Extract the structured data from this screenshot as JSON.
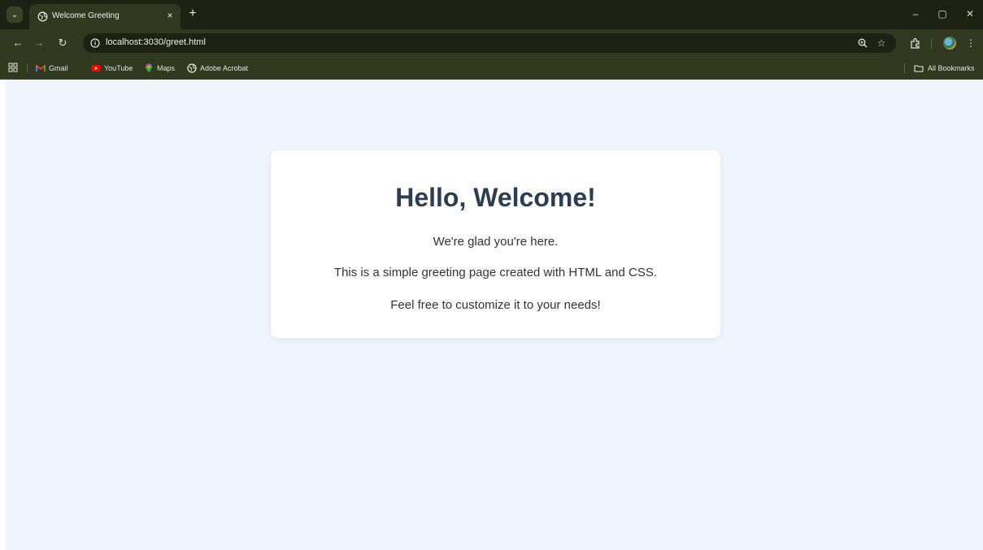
{
  "browser": {
    "tab": {
      "title": "Welcome Greeting",
      "close_symbol": "×",
      "favicon": "globe-icon"
    },
    "new_tab_symbol": "+",
    "window_controls": {
      "minimize": "–",
      "restore": "▢",
      "close": "✕"
    },
    "toolbar": {
      "back": "←",
      "forward": "→",
      "reload": "↻",
      "url": "localhost:3030/greet.html",
      "zoom_icon": "zoom-icon",
      "bookmark_star": "☆",
      "menu": "⋮"
    },
    "bookmarks": [
      {
        "label": "Gmail",
        "icon": "gmail-icon"
      },
      {
        "label": "YouTube",
        "icon": "youtube-icon"
      },
      {
        "label": "Maps",
        "icon": "maps-icon"
      },
      {
        "label": "Adobe Acrobat",
        "icon": "globe-icon"
      }
    ],
    "all_bookmarks": "All Bookmarks"
  },
  "page": {
    "heading": "Hello, Welcome!",
    "lines": [
      "We're glad you're here.",
      "This is a simple greeting page created with HTML and CSS.",
      "Feel free to customize it to your needs!"
    ]
  },
  "colors": {
    "chrome_dark": "#1c2112",
    "chrome": "#30381f",
    "page_background": "#eff5fc",
    "card": "#ffffff",
    "heading": "#2c3e50"
  }
}
